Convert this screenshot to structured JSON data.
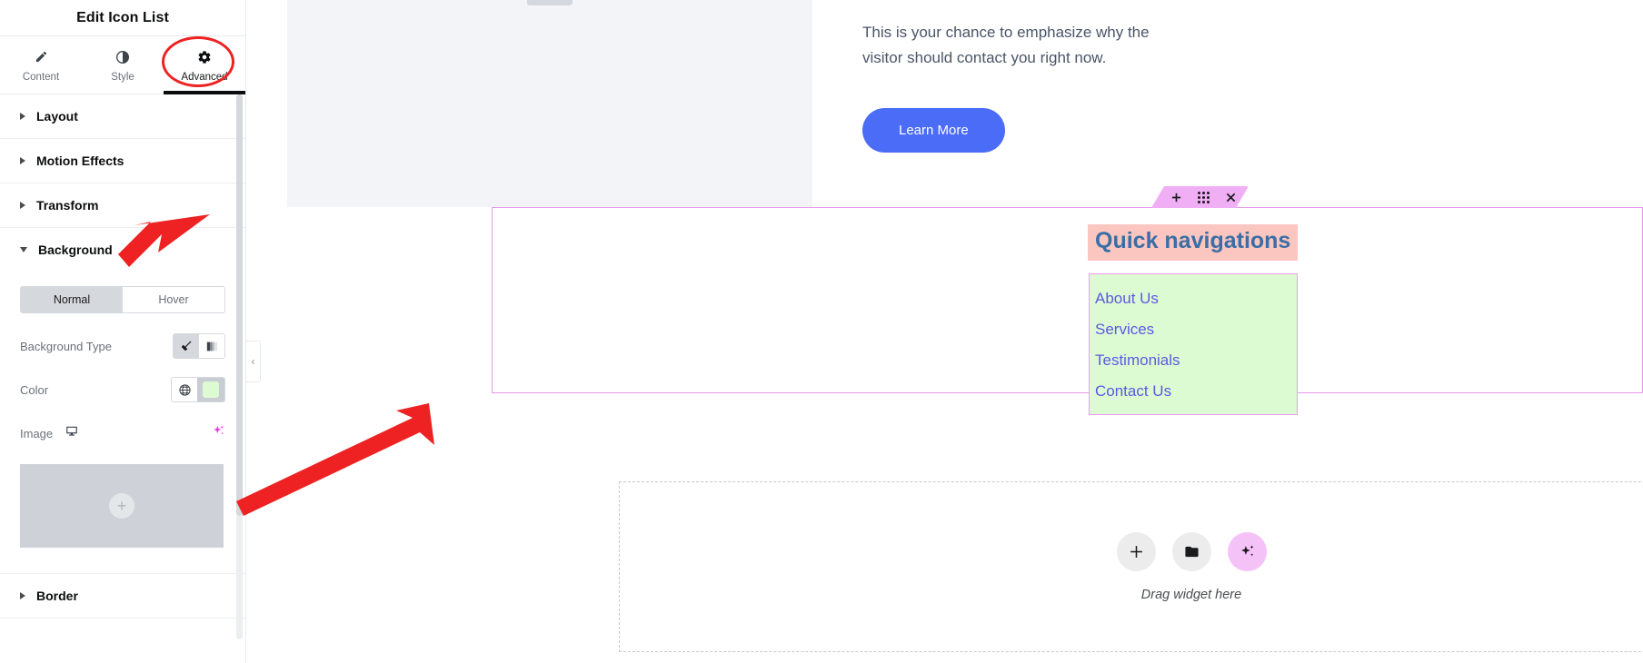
{
  "panel": {
    "title": "Edit Icon List",
    "tabs": [
      {
        "label": "Content",
        "icon": "pencil-icon",
        "active": false
      },
      {
        "label": "Style",
        "icon": "half-circle-icon",
        "active": false
      },
      {
        "label": "Advanced",
        "icon": "gear-icon",
        "active": true
      }
    ],
    "sections": [
      {
        "label": "Layout",
        "open": false
      },
      {
        "label": "Motion Effects",
        "open": false
      },
      {
        "label": "Transform",
        "open": false
      },
      {
        "label": "Background",
        "open": true
      },
      {
        "label": "Border",
        "open": false
      }
    ],
    "background": {
      "state_tabs": [
        {
          "label": "Normal",
          "active": true
        },
        {
          "label": "Hover",
          "active": false
        }
      ],
      "background_type": {
        "label": "Background Type",
        "options": [
          {
            "name": "classic",
            "icon": "paint-brush-icon",
            "active": true
          },
          {
            "name": "gradient",
            "icon": "gradient-icon",
            "active": false
          }
        ]
      },
      "color": {
        "label": "Color",
        "globe_icon": "globe-icon",
        "swatch_hex": "#ddfbd3",
        "swatch_bg_hex": "#c9ccd2"
      },
      "image": {
        "label": "Image",
        "device_icon": "monitor-icon",
        "ai_icon": "sparkle-icon",
        "upload_icon": "plus-icon"
      }
    }
  },
  "canvas": {
    "collapse_handle_icon": "chevron-left-icon",
    "hero": {
      "paragraph": "This is your chance to emphasize why the visitor should contact you right now.",
      "button_label": "Learn More",
      "button_color": "#4a6cf7"
    },
    "quick_nav": {
      "toolbar": [
        {
          "name": "add-element-button",
          "icon": "plus-icon"
        },
        {
          "name": "drag-handle",
          "icon": "grid-dots-icon"
        },
        {
          "name": "delete-button",
          "icon": "close-icon"
        }
      ],
      "heading": "Quick navigations",
      "heading_bg_hex": "#fbc6c0",
      "heading_color_hex": "#3a6ea5",
      "list_bg_hex": "#ddfbd3",
      "list_border_hex": "#ef9bef",
      "items": [
        "About Us",
        "Services",
        "Testimonials",
        "Contact Us"
      ]
    },
    "dropzone": {
      "buttons": [
        {
          "name": "add-widget-button",
          "icon": "plus-icon"
        },
        {
          "name": "add-template-button",
          "icon": "folder-icon"
        },
        {
          "name": "ai-button",
          "icon": "sparkle-icon"
        }
      ],
      "label": "Drag widget here"
    }
  },
  "annotations": {
    "highlight_color": "#ee2222",
    "arrow_to_background": "arrow-icon",
    "arrow_to_color_swatch": "arrow-icon",
    "ellipse_on_advanced_tab": "ellipse-highlight"
  }
}
